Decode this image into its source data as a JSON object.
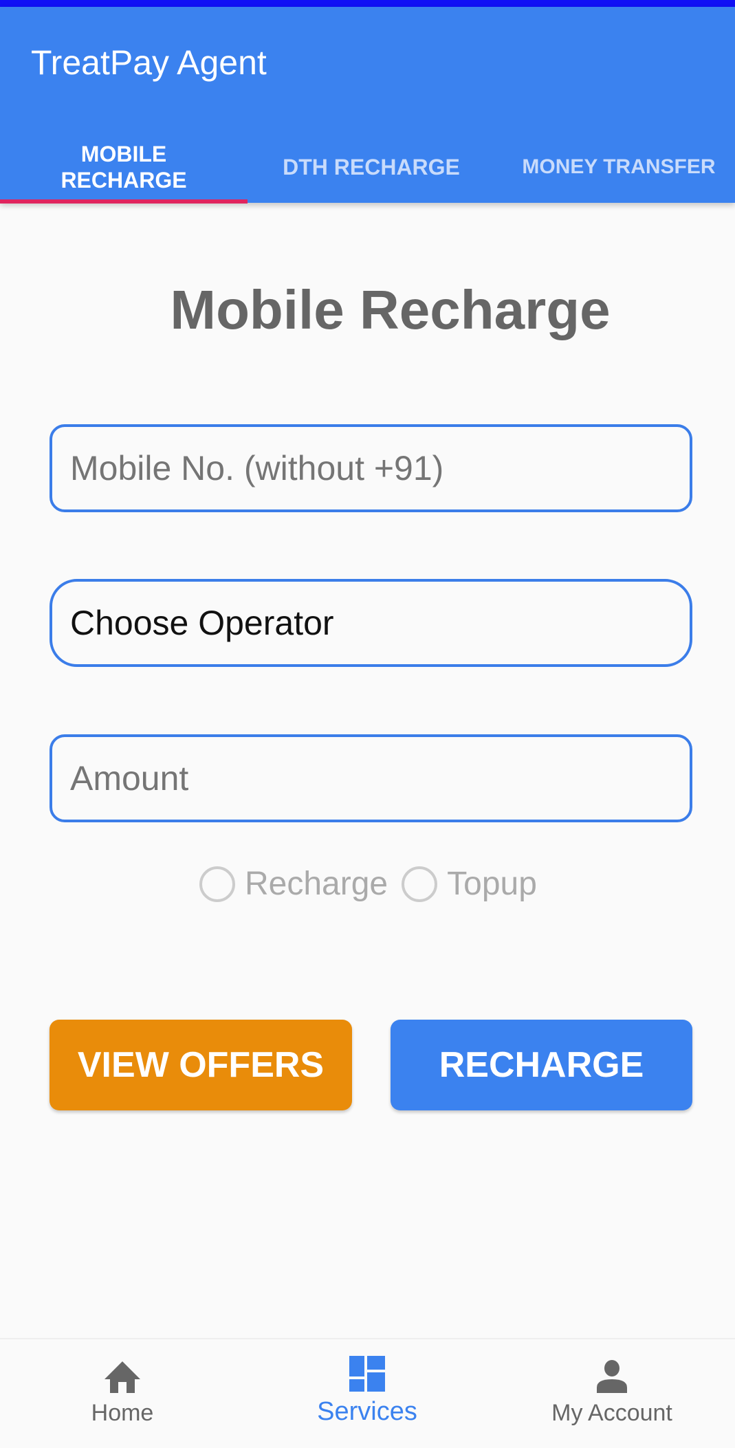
{
  "app": {
    "title": "TreatPay Agent"
  },
  "tabs": [
    {
      "label": "MOBILE RECHARGE",
      "active": true
    },
    {
      "label": "DTH RECHARGE",
      "active": false
    },
    {
      "label": "MONEY TRANSFER",
      "active": false
    }
  ],
  "page": {
    "title": "Mobile Recharge"
  },
  "form": {
    "mobile_placeholder": "Mobile No. (without +91)",
    "operator_value": "Choose Operator",
    "amount_placeholder": "Amount",
    "radio_recharge": "Recharge",
    "radio_topup": "Topup"
  },
  "buttons": {
    "view_offers": "VIEW OFFERS",
    "recharge": "RECHARGE"
  },
  "nav": [
    {
      "label": "Home",
      "icon": "home-icon"
    },
    {
      "label": "Services",
      "icon": "dashboard-icon",
      "active": true
    },
    {
      "label": "My Account",
      "icon": "person-icon"
    }
  ],
  "colors": {
    "primary": "#3b82ef",
    "accent": "#e0245e",
    "orange": "#e98c0a"
  }
}
